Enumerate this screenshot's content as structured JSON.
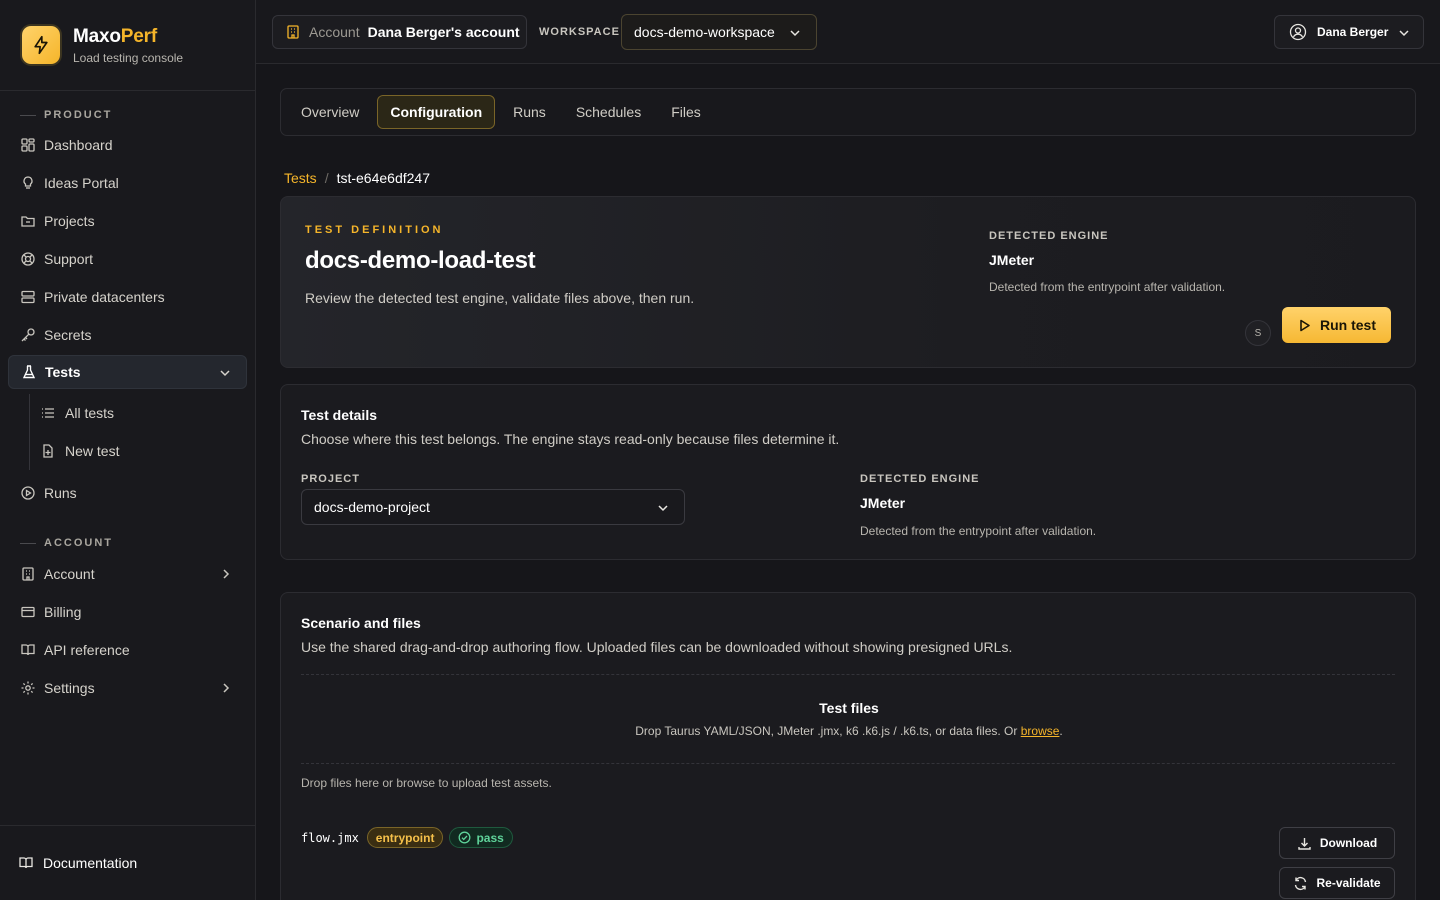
{
  "brand": {
    "name_main": "Maxo",
    "name_accent": "Perf",
    "subtitle": "Load testing console",
    "icon": "bolt-icon"
  },
  "sidebar": {
    "product_section": "PRODUCT",
    "account_section": "ACCOUNT",
    "items": [
      {
        "label": "Dashboard",
        "icon": "grid-icon"
      },
      {
        "label": "Ideas Portal",
        "icon": "lightbulb-icon"
      },
      {
        "label": "Projects",
        "icon": "folder-icon"
      },
      {
        "label": "Support",
        "icon": "lifebuoy-icon"
      },
      {
        "label": "Private datacenters",
        "icon": "server-icon"
      },
      {
        "label": "Secrets",
        "icon": "key-icon"
      },
      {
        "label": "Tests",
        "icon": "flask-icon",
        "active": true
      },
      {
        "label": "All tests",
        "icon": "list-icon"
      },
      {
        "label": "New test",
        "icon": "file-plus-icon"
      },
      {
        "label": "Runs",
        "icon": "play-circle-icon"
      }
    ],
    "account_items": [
      {
        "label": "Account",
        "icon": "building-icon"
      },
      {
        "label": "Billing",
        "icon": "card-icon"
      },
      {
        "label": "API reference",
        "icon": "book-icon"
      },
      {
        "label": "Settings",
        "icon": "gear-icon"
      }
    ],
    "footer": {
      "label": "Documentation",
      "icon": "book-open-icon"
    }
  },
  "topbar": {
    "account_label": "Account",
    "account_value": "Dana Berger's account",
    "workspace_label": "WORKSPACE",
    "workspace_value": "docs-demo-workspace",
    "user_name": "Dana Berger"
  },
  "tabs": [
    "Overview",
    "Configuration",
    "Runs",
    "Schedules",
    "Files"
  ],
  "active_tab": "Configuration",
  "breadcrumb": {
    "root": "Tests",
    "separator": "/",
    "current": "tst-e64e6df247"
  },
  "hero": {
    "eyebrow": "TEST DEFINITION",
    "title": "docs-demo-load-test",
    "description": "Review the detected test engine, validate files above, then run.",
    "engine_label": "DETECTED ENGINE",
    "engine_value": "JMeter",
    "engine_note": "Detected from the entrypoint after validation.",
    "shortcut": "S",
    "run_label": "Run test"
  },
  "details": {
    "title": "Test details",
    "description": "Choose where this test belongs. The engine stays read-only because files determine it.",
    "project_label": "PROJECT",
    "project_value": "docs-demo-project",
    "engine_label": "DETECTED ENGINE",
    "engine_value": "JMeter",
    "engine_note": "Detected from the entrypoint after validation."
  },
  "files": {
    "title": "Scenario and files",
    "description": "Use the shared drag-and-drop authoring flow. Uploaded files can be downloaded without showing presigned URLs.",
    "drop_title": "Test files",
    "drop_hint": "Drop Taurus YAML/JSON, JMeter .jmx, k6 .k6.js / .k6.ts, or data files. Or",
    "browse_link": "browse",
    "drop_hint_end": ".",
    "drop_note": "Drop files here or browse to upload test assets.",
    "file_name": "flow.jmx",
    "badge_entry": "entrypoint",
    "badge_status": "pass",
    "download_label": "Download",
    "revalidate_label": "Re-validate"
  },
  "colors": {
    "accent": "#f5b52a",
    "background": "#16161a",
    "success": "#5fd39a"
  }
}
